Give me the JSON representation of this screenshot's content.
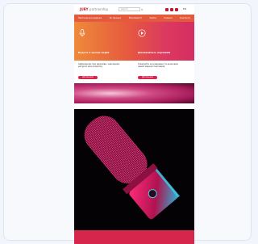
{
  "header": {
    "logo_main": "JURY",
    "logo_sub": "partnership",
    "search_placeholder": "Search",
    "search_button": "Q",
    "language": "EN"
  },
  "nav": {
    "items": [
      "Партнерська мережа",
      "Як працює",
      "Можливості",
      "Кейси",
      "Новини",
      "Контакти"
    ]
  },
  "left_pane": {
    "icon": "microphone-icon",
    "title": "Будьте в центрі подій",
    "text": "Інформуємо про важливе, знаходимо ресурси для розвитку",
    "button": "Детальніше"
  },
  "right_pane": {
    "icon": "play-circle-icon",
    "title": "Дізнавайтесь першими",
    "text": "Слідкуйте за новинами та анонсами нашої мережі партнерів",
    "button": "Детальніше"
  },
  "colors": {
    "accent": "#d7264c",
    "hero_start": "#ee8a3a",
    "hero_end": "#d42d62",
    "nav": "#e35a3c"
  }
}
